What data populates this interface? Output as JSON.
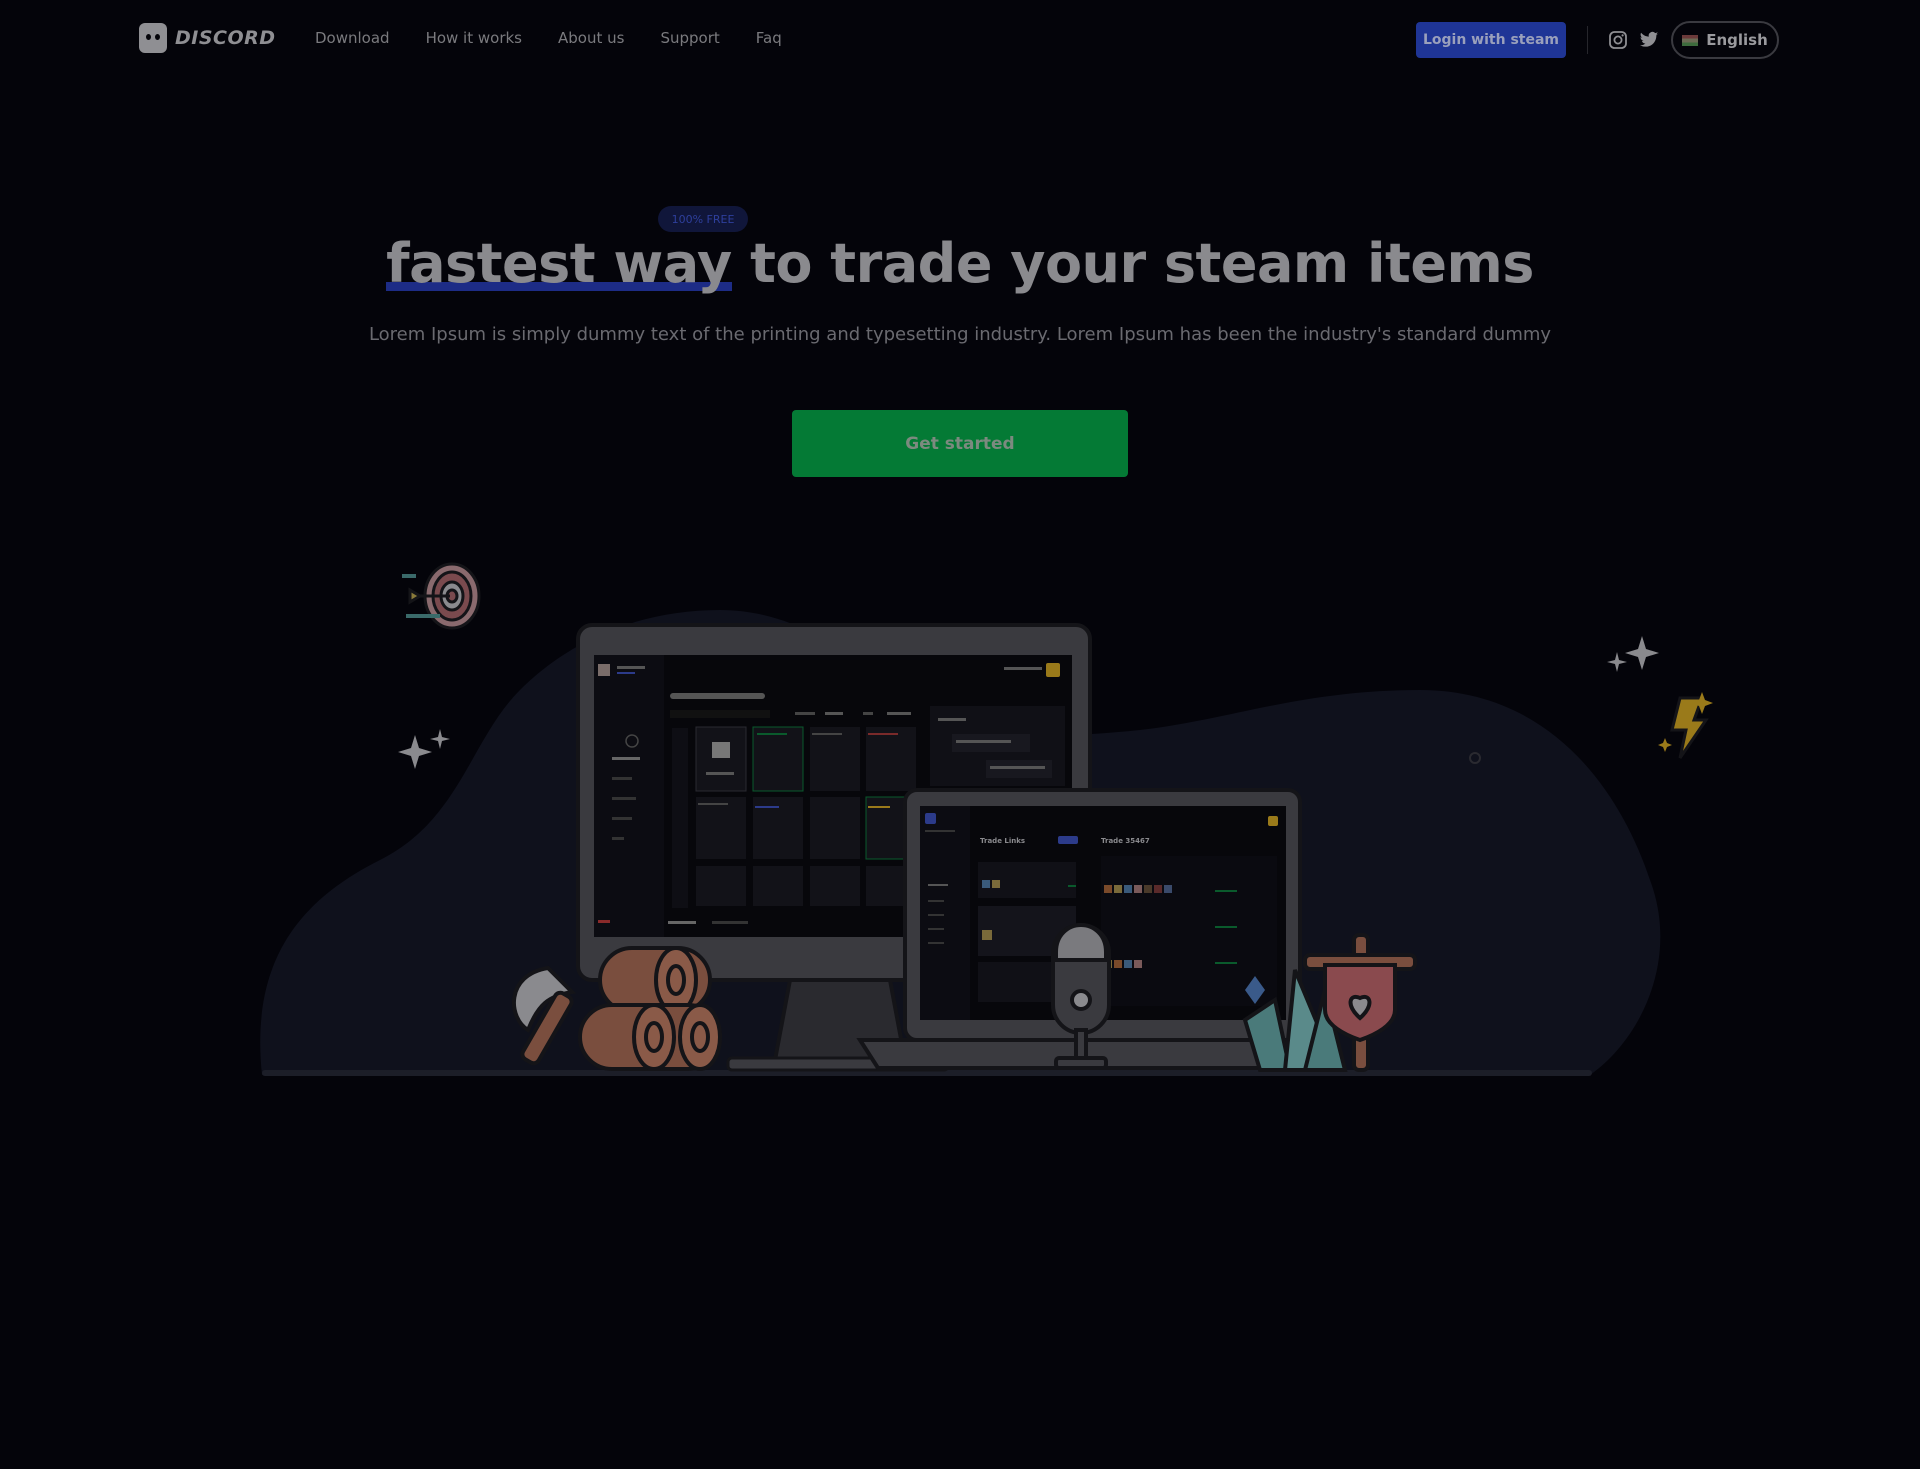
{
  "brand": {
    "name": "DISCORD"
  },
  "nav": {
    "items": [
      {
        "label": "Download"
      },
      {
        "label": "How it works"
      },
      {
        "label": "About us"
      },
      {
        "label": "Support"
      },
      {
        "label": "Faq"
      }
    ]
  },
  "header": {
    "login_label": "Login with steam",
    "language": "English",
    "social": [
      "instagram-icon",
      "twitter-icon"
    ]
  },
  "hero": {
    "badge": "100% FREE",
    "title_highlight": "fastest way",
    "title_rest": " to trade your steam items",
    "subtitle": "Lorem Ipsum is simply dummy text of the printing and typesetting industry. Lorem Ipsum has been the industry's standard dummy",
    "cta_label": "Get started"
  },
  "illustration": {
    "laptop_screen": {
      "left_title": "Trade Links",
      "right_title": "Trade 35467"
    }
  },
  "colors": {
    "background": "#04040a",
    "accent_blue": "#1f3596",
    "cta_green": "#047a35",
    "text": "#8a8a8e"
  }
}
